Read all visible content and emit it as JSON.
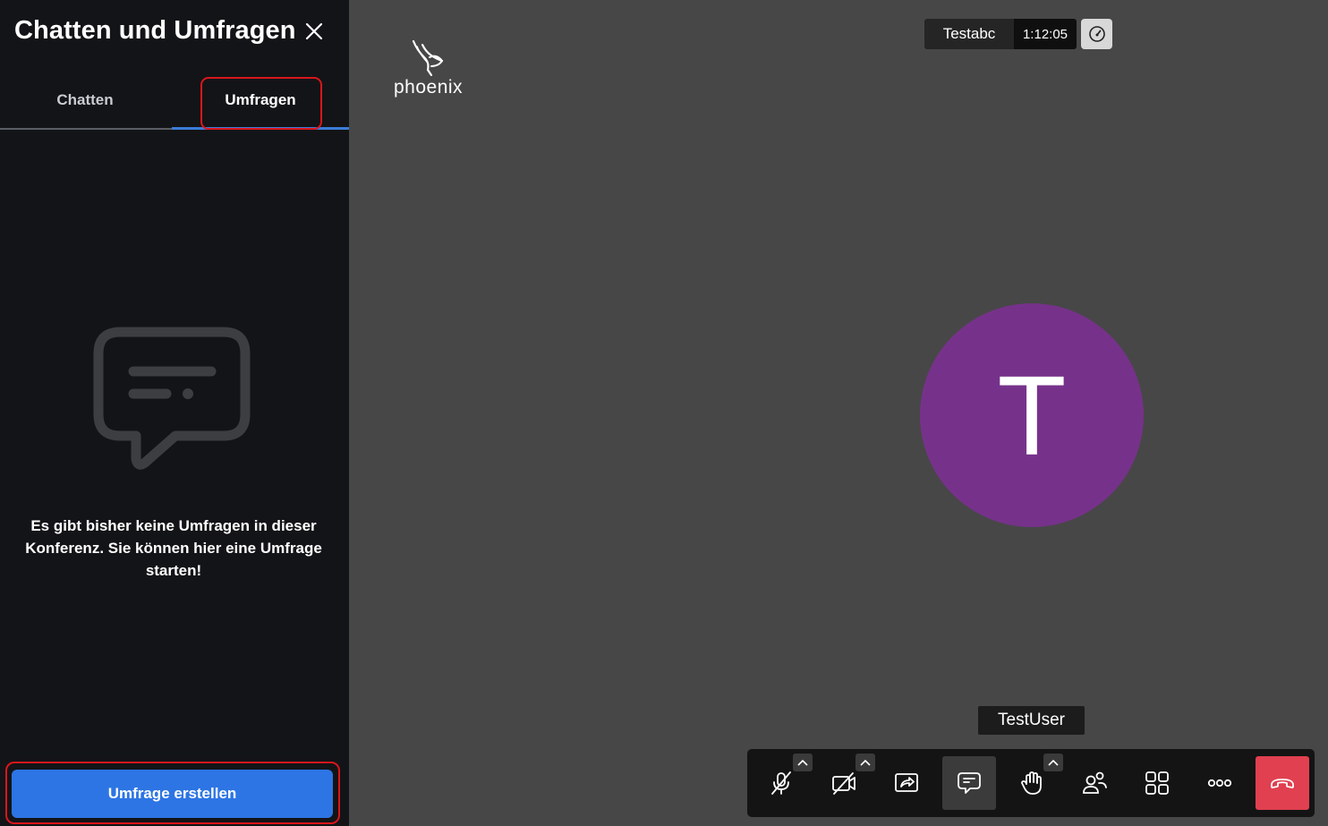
{
  "sidebar": {
    "title": "Chatten und Umfragen",
    "tabs": [
      {
        "label": "Chatten",
        "selected": false
      },
      {
        "label": "Umfragen",
        "selected": true
      }
    ],
    "empty_icon": "poll-chat-bubble-icon",
    "empty_message": "Es gibt bisher keine Umfragen in dieser Konferenz. Sie können hier eine Umfrage starten!",
    "create_button_label": "Umfrage erstellen"
  },
  "main": {
    "logo_text": "phoenix",
    "meeting_name": "Testabc",
    "timer": "1:12:05",
    "avatar_initial": "T",
    "participant_name": "TestUser"
  },
  "toolbar": {
    "buttons": [
      {
        "icon": "microphone-muted-icon",
        "has_menu": true
      },
      {
        "icon": "camera-off-icon",
        "has_menu": true
      },
      {
        "icon": "screen-share-icon",
        "has_menu": false
      },
      {
        "icon": "chat-icon",
        "active": true
      },
      {
        "icon": "raise-hand-icon",
        "has_menu": true
      },
      {
        "icon": "participants-icon",
        "has_menu": false
      },
      {
        "icon": "tile-view-icon",
        "has_menu": false
      },
      {
        "icon": "more-options-icon",
        "has_menu": false
      },
      {
        "icon": "hangup-icon",
        "has_menu": false
      }
    ]
  },
  "colors": {
    "sidebar_bg": "#131417",
    "main_bg": "#474747",
    "accent_blue": "#2d75e4",
    "avatar_purple": "#76328a",
    "hangup_red": "#e0404f",
    "highlight_red": "#d9161b"
  }
}
